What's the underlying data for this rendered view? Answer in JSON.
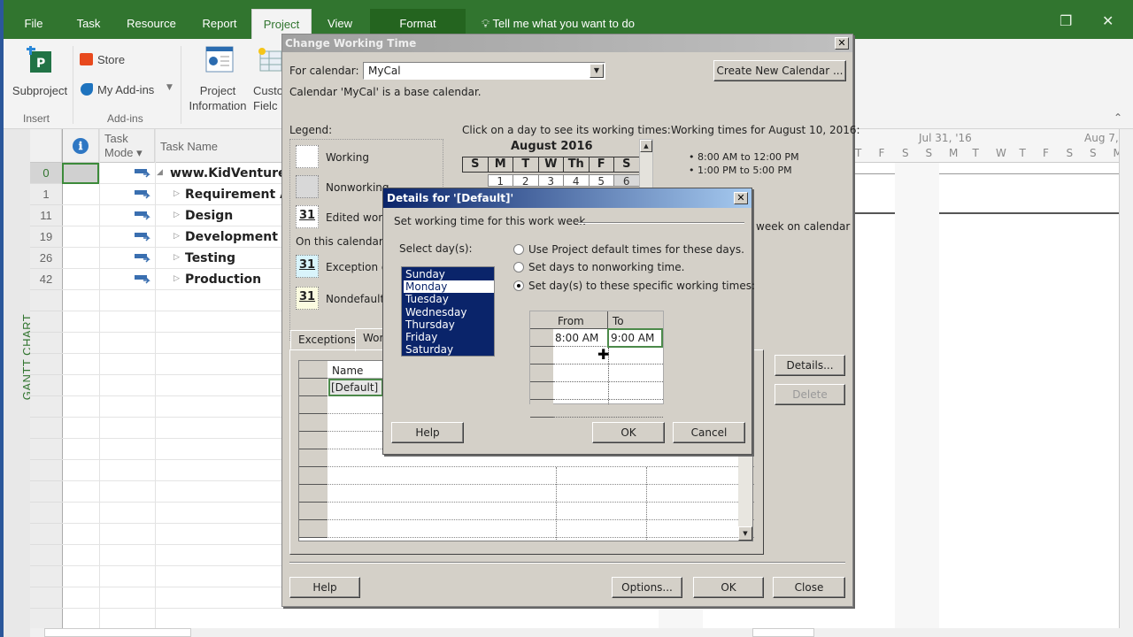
{
  "app": {
    "tabs": [
      {
        "label": "File"
      },
      {
        "label": "Task"
      },
      {
        "label": "Resource"
      },
      {
        "label": "Report"
      },
      {
        "label": "Project",
        "active": true
      },
      {
        "label": "View"
      },
      {
        "label": "Format"
      }
    ],
    "tell_me": "Tell me what you want to do",
    "window_controls": {
      "restore": "❐",
      "close": "✕"
    }
  },
  "ribbon": {
    "groups": [
      {
        "label": "Insert",
        "buttons": [
          {
            "label": "Subproject",
            "icon": "subproject-icon"
          }
        ]
      },
      {
        "label": "Add-ins",
        "buttons": [
          {
            "label": "Store",
            "icon": "store-icon"
          },
          {
            "label": "My Add-ins",
            "icon": "addins-icon"
          }
        ]
      },
      {
        "label": "",
        "buttons": [
          {
            "label_line1": "Project",
            "label_line2": "Information",
            "icon": "project-info-icon"
          },
          {
            "label_line1": "Custo",
            "label_line2": "Fielc",
            "icon": "custom-fields-icon"
          }
        ]
      }
    ]
  },
  "view_rail": {
    "label": "GANTT CHART"
  },
  "task_grid": {
    "columns": {
      "info": "ℹ",
      "mode_line1": "Task",
      "mode_line2": "Mode ▾",
      "name": "Task Name"
    },
    "rows": [
      {
        "id": "0",
        "name": "www.KidVenture",
        "expander": "◢"
      },
      {
        "id": "1",
        "name": "Requirement An",
        "expander": "▷"
      },
      {
        "id": "11",
        "name": "Design",
        "expander": "▷"
      },
      {
        "id": "19",
        "name": "Development",
        "expander": "▷"
      },
      {
        "id": "26",
        "name": "Testing",
        "expander": "▷"
      },
      {
        "id": "42",
        "name": "Production",
        "expander": "▷"
      }
    ]
  },
  "gantt": {
    "week1": "Jul 31, '16",
    "week2": "Aug 7,",
    "days": [
      "T",
      "F",
      "S",
      "S",
      "M",
      "T",
      "W",
      "T",
      "F",
      "S",
      "S",
      "M"
    ]
  },
  "change_working_time": {
    "title": "Change Working Time",
    "for_calendar_label": "For calendar:",
    "for_calendar_value": "MyCal",
    "create_new_label": "Create New Calendar ...",
    "base_note": "Calendar 'MyCal' is a base calendar.",
    "legend_label": "Legend:",
    "legend_items": [
      {
        "label": "Working",
        "glyph": ""
      },
      {
        "label": "Nonworking",
        "glyph": ""
      },
      {
        "label": "Edited work",
        "glyph": "31"
      }
    ],
    "on_this_calendar_label": "On this calendar:",
    "calendar_items": [
      {
        "label": "Exception d",
        "glyph": "31"
      },
      {
        "label": "Nondefault",
        "glyph": "31"
      }
    ],
    "click_hint": "Click on a day to see its working times:",
    "month": "August 2016",
    "weekdays": [
      "S",
      "M",
      "T",
      "W",
      "Th",
      "F",
      "S"
    ],
    "first_week": [
      "",
      "1",
      "2",
      "3",
      "4",
      "5",
      "6"
    ],
    "working_times_title": "Working times for August 10, 2016:",
    "working_times": [
      "• 8:00 AM to 12:00 PM",
      "• 1:00 PM to 5:00 PM"
    ],
    "week_on_calendar_fragment": "week on calendar",
    "tabs": [
      {
        "label": "Exceptions"
      },
      {
        "label": "Wor"
      }
    ],
    "exceptions_grid": {
      "header": "Name",
      "rows": [
        "[Default]"
      ]
    },
    "details_button": "Details...",
    "delete_button": "Delete",
    "help_button": "Help",
    "options_button": "Options...",
    "ok_button": "OK",
    "close_button": "Close"
  },
  "details_dialog": {
    "title": "Details for '[Default]'",
    "section_label": "Set working time for this work week",
    "select_days_label": "Select day(s):",
    "days": [
      "Sunday",
      "Monday",
      "Tuesday",
      "Wednesday",
      "Thursday",
      "Friday",
      "Saturday"
    ],
    "selected_days": [
      "Sunday",
      "Tuesday",
      "Wednesday",
      "Thursday",
      "Friday",
      "Saturday"
    ],
    "focused_day": "Monday",
    "options": [
      {
        "label": "Use Project default times for these days.",
        "checked": false
      },
      {
        "label": "Set days to nonworking time.",
        "checked": false
      },
      {
        "label": "Set day(s) to these specific working times:",
        "checked": true
      }
    ],
    "times_grid": {
      "from_header": "From",
      "to_header": "To",
      "rows": [
        {
          "from": "8:00 AM",
          "to": "9:00 AM"
        }
      ]
    },
    "help_button": "Help",
    "ok_button": "OK",
    "cancel_button": "Cancel"
  }
}
